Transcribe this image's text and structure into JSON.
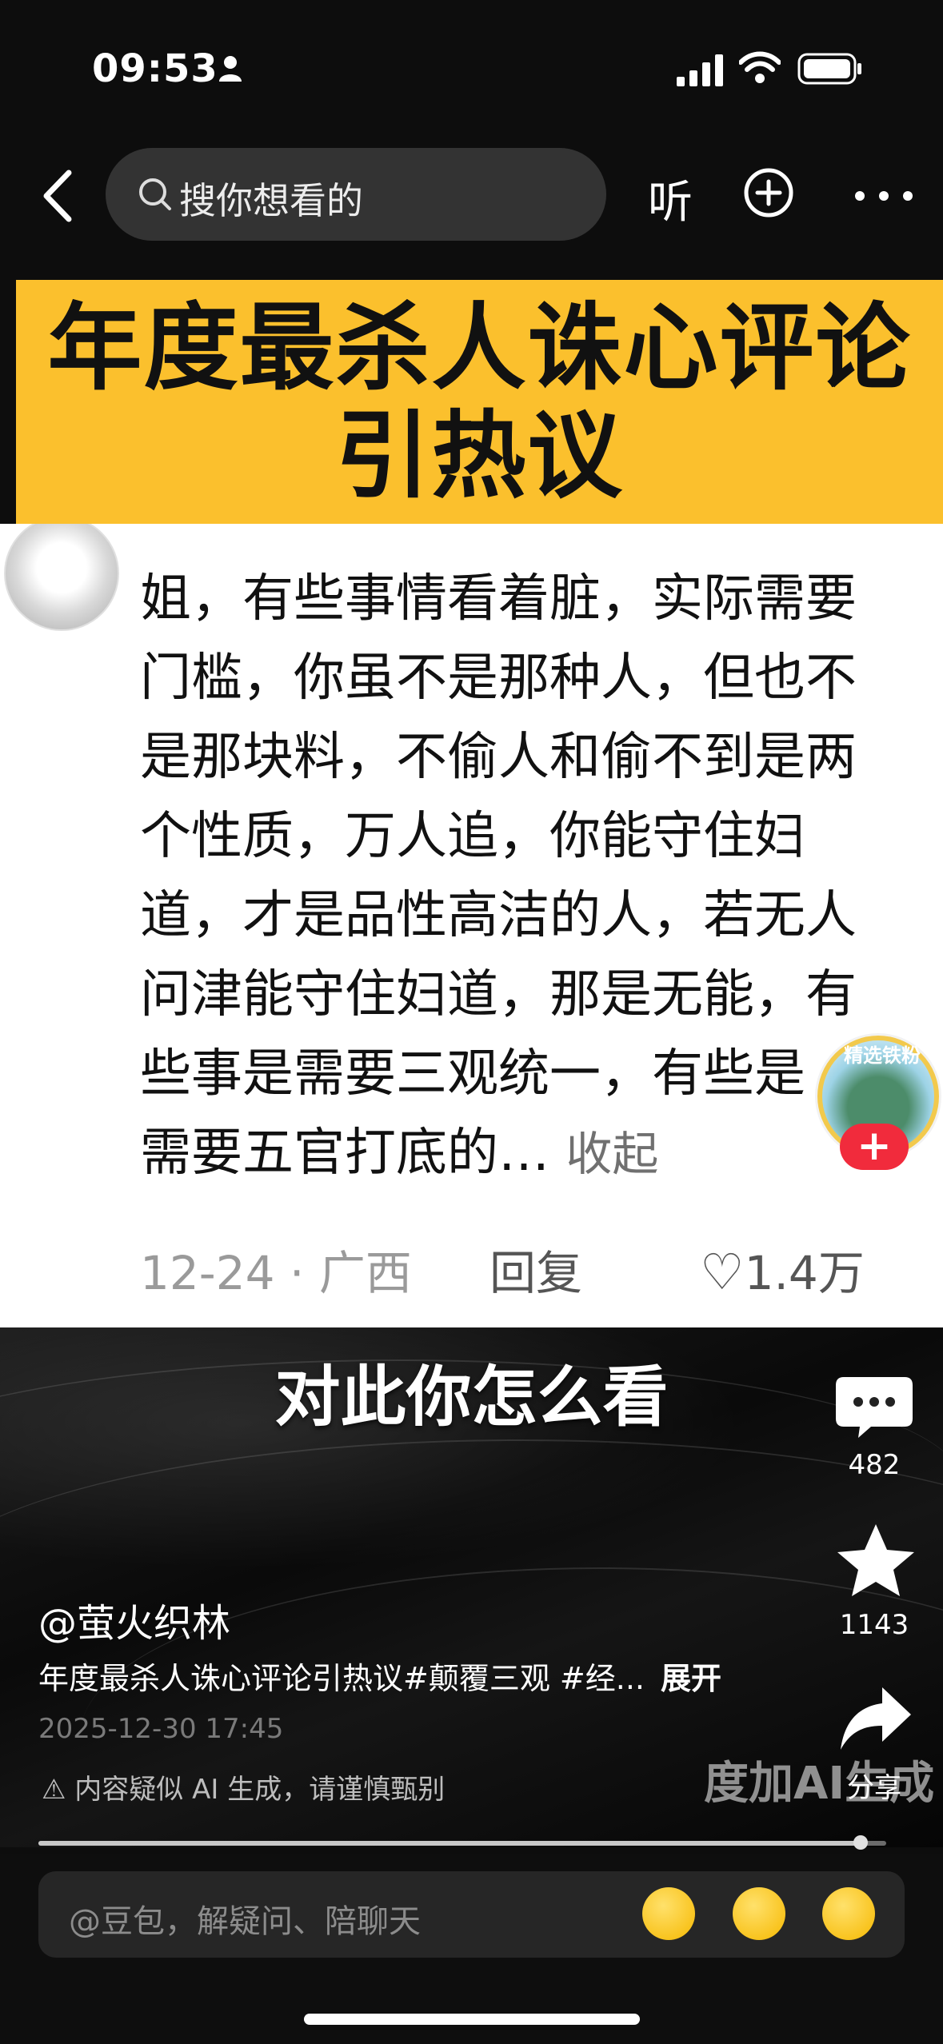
{
  "status_bar": {
    "time": "09:53"
  },
  "top_nav": {
    "search_placeholder": "搜你想看的",
    "listen_label": "听"
  },
  "banner": {
    "title": "年度最杀人诛心评论引热议"
  },
  "comment": {
    "lines": [
      "姐，有些事情看着脏，实际需要",
      "门槛，你虽不是那种人，但也不",
      "是那块料，不偷人和偷不到是两",
      "个性质，万人追，你能守住妇",
      "道，才是品性高洁的人，若无人",
      "问津能守住妇道，那是无能，有",
      "些事是需要三观统一，有些是",
      "需要五官打底的…"
    ],
    "collapse_label": "收起",
    "date_location": "12-24 · 广西",
    "reply_label": "回复",
    "likes": "1.4万"
  },
  "floating_badge": {
    "label": "精选铁粉",
    "plus": "+"
  },
  "video": {
    "caption": "对此你怎么看",
    "author": "@萤火织林",
    "description": "年度最杀人诛心评论引热议#颠覆三观 #经...",
    "expand_label": "展开",
    "date": "2025-12-30 17:45",
    "ai_notice": "内容疑似 AI 生成，请谨慎甄别",
    "watermark": "度加AI生成",
    "progress": 0.97
  },
  "actions": {
    "comment_count": "482",
    "star_count": "1143",
    "share_label": "分享"
  },
  "bottom_input": {
    "placeholder": "@豆包，解疑问、陪聊天"
  },
  "icons": {
    "status": [
      "person-icon",
      "signal-icon",
      "wifi-icon",
      "battery-icon"
    ],
    "nav": [
      "back-icon",
      "search-icon",
      "plus-circle-icon",
      "more-icon"
    ],
    "side": [
      "comment-icon",
      "star-icon",
      "share-icon"
    ],
    "emoji": [
      "grin-emoji-icon",
      "crying-emoji-icon",
      "laughing-emoji-icon"
    ]
  },
  "colors": {
    "banner": "#fbc02d",
    "plus_badge": "#f12b3c"
  }
}
